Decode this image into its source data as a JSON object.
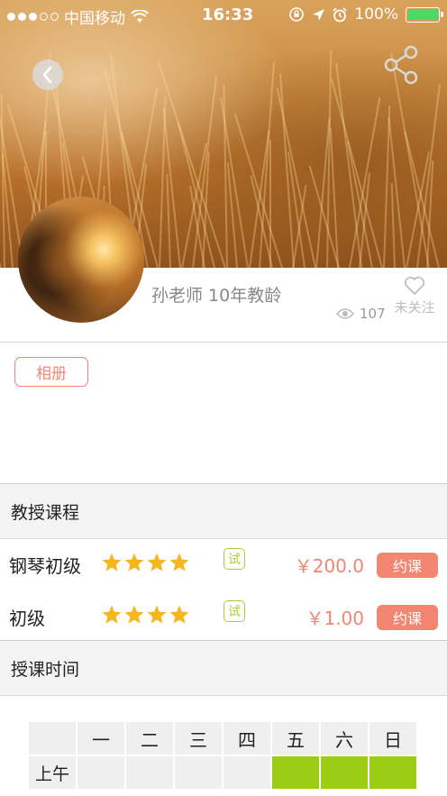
{
  "status_bar": {
    "carrier": "中国移动",
    "time": "16:33",
    "battery": "100%",
    "battery_level": 1.0
  },
  "header": {
    "back_icon": "chevron-left-icon",
    "share_icon": "share-icon"
  },
  "profile": {
    "name": "孙老师 10年教龄",
    "views": "107",
    "follow_label": "未关注"
  },
  "album": {
    "label": "相册"
  },
  "courses_section": {
    "title": "教授课程"
  },
  "courses": [
    {
      "name": "钢琴初级",
      "rating": 4,
      "trial_label": "试",
      "price": "￥200.0",
      "book_label": "约课"
    },
    {
      "name": "初级",
      "rating": 4,
      "trial_label": "试",
      "price": "￥1.00",
      "book_label": "约课"
    }
  ],
  "schedule_section": {
    "title": "授课时间"
  },
  "schedule": {
    "days": [
      "一",
      "二",
      "三",
      "四",
      "五",
      "六",
      "日"
    ],
    "rows": [
      {
        "label": "上午",
        "available": [
          false,
          false,
          false,
          false,
          true,
          true,
          true
        ]
      }
    ]
  },
  "colors": {
    "accent": "#f28672",
    "available": "#9ccc15",
    "star": "#f6b71e",
    "trial": "#a8cf3a"
  }
}
